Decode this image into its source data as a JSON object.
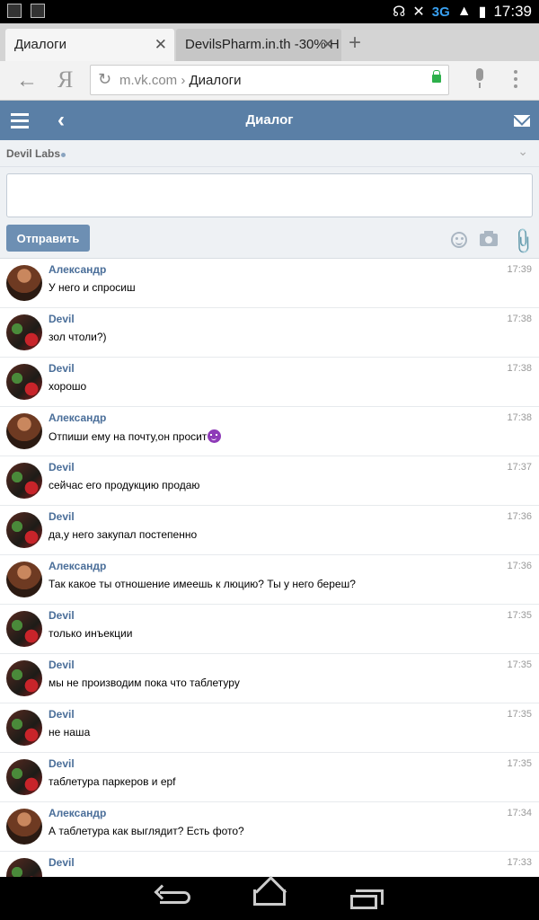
{
  "statusbar": {
    "network": "3G",
    "clock": "17:39"
  },
  "tabs": [
    {
      "label": "Диалоги",
      "close": "✕"
    },
    {
      "label": "DevilsPharm.in.th -30% H",
      "close": "✕"
    }
  ],
  "newtab": "+",
  "browser": {
    "url_host": "m.vk.com",
    "url_sep": " › ",
    "url_path": "Диалоги",
    "yandex_logo": "Я",
    "back": "←",
    "reload": "↻"
  },
  "vk": {
    "header_title": "Диалог",
    "dialog_name": "Devil Labs",
    "send_label": "Отправить",
    "message_placeholder": ""
  },
  "messages": [
    {
      "author": "Александр",
      "avatar": "aleksandr",
      "time": "17:39",
      "text": "У него и спросиш"
    },
    {
      "author": "Devil",
      "avatar": "devil",
      "time": "17:38",
      "text": "зол чтоли?)"
    },
    {
      "author": "Devil",
      "avatar": "devil",
      "time": "17:38",
      "text": "хорошо"
    },
    {
      "author": "Александр",
      "avatar": "aleksandr",
      "time": "17:38",
      "text": "Отпиши ему на почту,он просит",
      "emoji": "devil"
    },
    {
      "author": "Devil",
      "avatar": "devil",
      "time": "17:37",
      "text": "сейчас его продукцию продаю"
    },
    {
      "author": "Devil",
      "avatar": "devil",
      "time": "17:36",
      "text": "да,у него закупал постепенно"
    },
    {
      "author": "Александр",
      "avatar": "aleksandr",
      "time": "17:36",
      "text": "Так какое ты отношение имеешь к люцию? Ты у него береш?"
    },
    {
      "author": "Devil",
      "avatar": "devil",
      "time": "17:35",
      "text": "только инъекции"
    },
    {
      "author": "Devil",
      "avatar": "devil",
      "time": "17:35",
      "text": "мы не производим пока что таблетуру"
    },
    {
      "author": "Devil",
      "avatar": "devil",
      "time": "17:35",
      "text": "не наша"
    },
    {
      "author": "Devil",
      "avatar": "devil",
      "time": "17:35",
      "text": "таблетура паркеров и epf"
    },
    {
      "author": "Александр",
      "avatar": "aleksandr",
      "time": "17:34",
      "text": "А таблетура как выглядит? Есть фото?"
    },
    {
      "author": "Devil",
      "avatar": "devil",
      "time": "17:33",
      "text": ""
    }
  ]
}
